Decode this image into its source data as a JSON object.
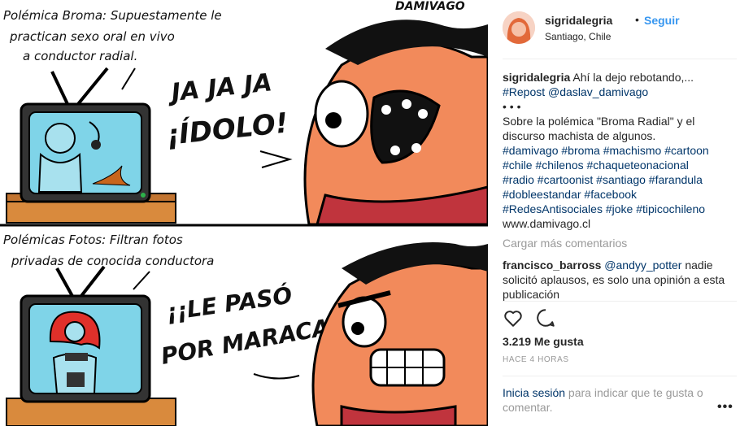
{
  "post": {
    "username": "sigridalegria",
    "follow_label": "Seguir",
    "dot": "•",
    "location": "Santiago, Chile"
  },
  "comic": {
    "signature": "DAMIVAGO",
    "panel1_caption_line1": "Polémica Broma: Supuestamente le",
    "panel1_caption_line2": "practican sexo oral en vivo",
    "panel1_caption_line3": "a conductor radial.",
    "panel1_speech_line1": "JA JA JA",
    "panel1_speech_line2": "¡ÍDOLO!",
    "panel2_caption_line1": "Polémicas Fotos: Filtran fotos",
    "panel2_caption_line2": "privadas de conocida conductora",
    "panel2_speech_line1": "¡¡LE PASÓ",
    "panel2_speech_line2": "POR MARACA!!"
  },
  "caption": {
    "username": "sigridalegria",
    "line1_text": " Ahí la dejo rebotando,...",
    "repost": "#Repost @daslav_damivago",
    "dots": "• • •",
    "body_line1": "Sobre la polémica \"Broma Radial\" y el",
    "body_line2": "discurso machista de algunos.",
    "tags_line1": "#damivago #broma #machismo #cartoon",
    "tags_line2": "#chile #chilenos #chaqueteonacional",
    "tags_line3": "#radio #cartoonist #santiago #farandula",
    "tags_line4": "#dobleestandar #facebook",
    "tags_line5": "#RedesAntisociales #joke #tipicochileno",
    "website": "www.damivago.cl"
  },
  "load_more": "Cargar más comentarios",
  "comment": {
    "username": "francisco_barross",
    "mention": "@andyy_potter",
    "text_line1": " nadie",
    "text_line2": "solicitó aplausos, es solo una opinión a esta",
    "text_line3": "publicación"
  },
  "actions": {
    "like_icon": "heart-icon",
    "comment_icon": "speech-bubble-icon"
  },
  "likes": "3.219 Me gusta",
  "time": "HACE 4 HORAS",
  "login": {
    "link": "Inicia sesión",
    "rest": " para indicar que te gusta o",
    "line2": "comentar."
  },
  "more_label": "•••",
  "colors": {
    "link": "#003569",
    "follow": "#3897f0",
    "muted": "#999999",
    "skin": "#f28a5b",
    "tv_screen": "#7fd4e8",
    "shirt": "#c0343d"
  }
}
